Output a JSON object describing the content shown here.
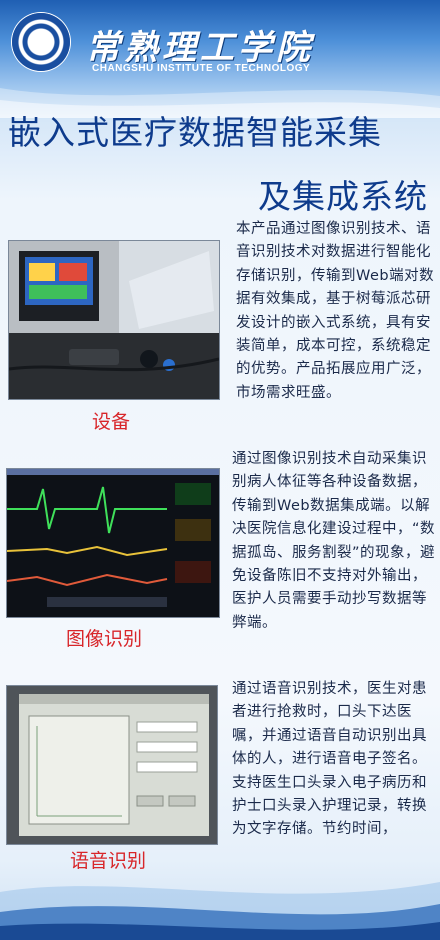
{
  "header": {
    "school_cn": "常熟理工学院",
    "school_en": "CHANGSHU INSTITUTE OF TECHNOLOGY",
    "logo_ring_text": "常熟理工学院"
  },
  "title": {
    "line1": "嵌入式医疗数据智能采集",
    "line2": "及集成系统"
  },
  "sections": [
    {
      "caption": "设备",
      "paragraph": "本产品通过图像识别技术、语音识别技术对数据进行智能化存储识别，传输到Web端对数据有效集成，基于树莓派芯研发设计的嵌入式系统，具有安装简单，成本可控，系统稳定的优势。产品拓展应用广泛，市场需求旺盛。"
    },
    {
      "caption": "图像识别",
      "paragraph": "通过图像识别技术自动采集识别病人体征等各种设备数据，传输到Web数据集成端。以解决医院信息化建设过程中，“数据孤岛、服务割裂”的现象，避免设备陈旧不支持对外输出，医护人员需要手动抄写数据等弊端。"
    },
    {
      "caption": "语音识别",
      "paragraph": "通过语音识别技术，医生对患者进行抢救时，口头下达医嘱，并通过语音自动识别出具体的人，进行语音电子签名。支持医生口头录入电子病历和护士口头录入护理记录，转换为文字存储。节约时间，"
    }
  ],
  "colors": {
    "title": "#0e3b8c",
    "caption": "#d8262a",
    "header_blue": "#1f5fb3"
  }
}
